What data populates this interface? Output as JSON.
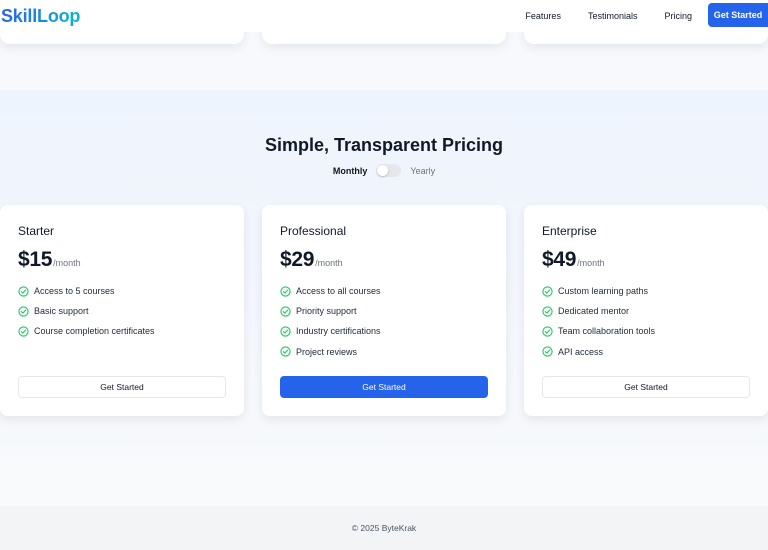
{
  "nav": {
    "logo": "SkillLoop",
    "links": [
      "Features",
      "Testimonials",
      "Pricing"
    ],
    "cta": "Get Started"
  },
  "pricing": {
    "title": "Simple, Transparent Pricing",
    "toggle": {
      "monthly": "Monthly",
      "yearly": "Yearly",
      "selected": "Monthly"
    },
    "plans": [
      {
        "name": "Starter",
        "price": "$15",
        "period": "/month",
        "features": [
          "Access to 5 courses",
          "Basic support",
          "Course completion certificates"
        ],
        "button": "Get Started"
      },
      {
        "name": "Professional",
        "price": "$29",
        "period": "/month",
        "features": [
          "Access to all courses",
          "Priority support",
          "Industry certifications",
          "Project reviews"
        ],
        "button": "Get Started"
      },
      {
        "name": "Enterprise",
        "price": "$49",
        "period": "/month",
        "features": [
          "Custom learning paths",
          "Dedicated mentor",
          "Team collaboration tools",
          "API access"
        ],
        "button": "Get Started"
      }
    ]
  },
  "footer": {
    "copyright": "© 2025 ByteKrak"
  },
  "colors": {
    "accent": "#2563eb",
    "check": "#22c55e"
  },
  "icons": {
    "feature_check": "check-circle-icon"
  }
}
